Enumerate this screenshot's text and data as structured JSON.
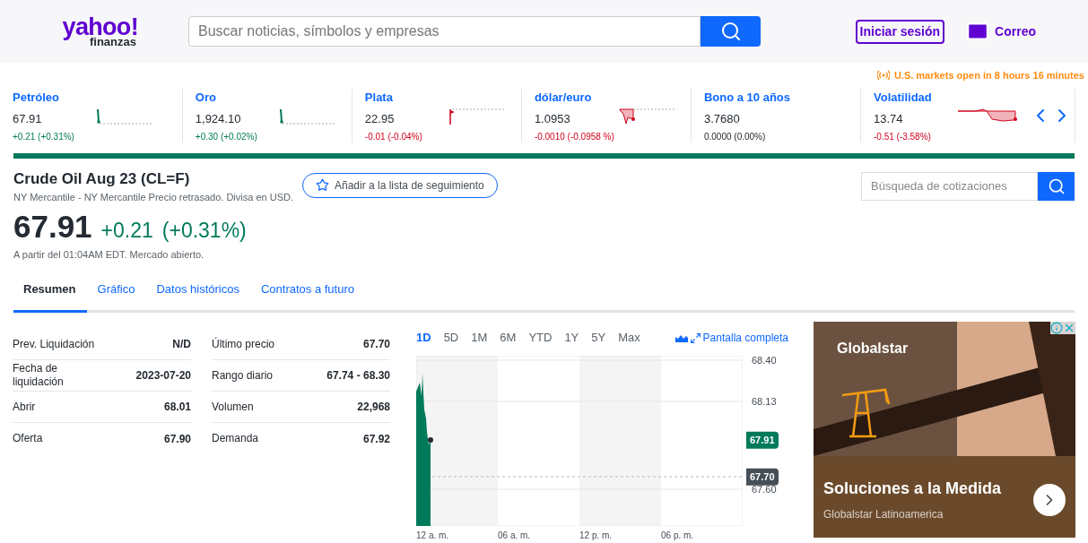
{
  "header": {
    "logo": {
      "brand": "yahoo!",
      "sub": "finanzas"
    },
    "search": {
      "placeholder": "Buscar noticias, símbolos y empresas"
    },
    "signin": "Iniciar sesión",
    "mail": "Correo"
  },
  "market_notice": "U.S. markets open in 8 hours 16 minutes",
  "tickers": [
    {
      "name": "Petróleo",
      "price": "67.91",
      "change": "+0.21 (+0.31%)",
      "kind": "spike"
    },
    {
      "name": "Oro",
      "price": "1,924.10",
      "change": "+0.30 (+0.02%)",
      "kind": "spike"
    },
    {
      "name": "Plata",
      "price": "22.95",
      "change": "-0.01 (-0.04%)",
      "kind": "drop"
    },
    {
      "name": "dólar/euro",
      "price": "1.0953",
      "change": "-0.0010 (-0.0958 %)",
      "kind": "dip"
    },
    {
      "name": "Bono a 10 años",
      "price": "3.7680",
      "change": "0.0000 (0.00%)",
      "kind": "plain"
    },
    {
      "name": "Volatilidad",
      "price": "13.74",
      "change": "-0.51 (-3.58%)",
      "kind": "slide"
    }
  ],
  "quote": {
    "title": "Crude Oil Aug 23 (CL=F)",
    "subtitle": "NY Mercantile - NY Mercantile Precio retrasado. Divisa en USD.",
    "watchlist": "Añadir a la lista de seguimiento",
    "price": "67.91",
    "change": "+0.21",
    "percent": "(+0.31%)",
    "timestamp": "A partir del 01:04AM EDT. Mercado abierto.",
    "quote_search_placeholder": "Búsqueda de cotizaciones"
  },
  "tabs": [
    {
      "label": "Resumen",
      "selected": true
    },
    {
      "label": "Gráfico",
      "selected": false
    },
    {
      "label": "Datos históricos",
      "selected": false
    },
    {
      "label": "Contratos a futuro",
      "selected": false
    }
  ],
  "stats": [
    [
      {
        "label": "Prev. Liquidación",
        "value": "N/D"
      },
      {
        "label": "Fecha de liquidación",
        "value": "2023-07-20"
      },
      {
        "label": "Abrir",
        "value": "68.01"
      },
      {
        "label": "Oferta",
        "value": "67.90"
      }
    ],
    [
      {
        "label": "Último precio",
        "value": "67.70"
      },
      {
        "label": "Rango diario",
        "value": "67.74 - 68.30"
      },
      {
        "label": "Volumen",
        "value": "22,968"
      },
      {
        "label": "Demanda",
        "value": "67.92"
      }
    ]
  ],
  "chart": {
    "ranges": [
      {
        "label": "1D",
        "selected": true
      },
      {
        "label": "5D",
        "selected": false
      },
      {
        "label": "1M",
        "selected": false
      },
      {
        "label": "6M",
        "selected": false
      },
      {
        "label": "YTD",
        "selected": false
      },
      {
        "label": "1Y",
        "selected": false
      },
      {
        "label": "5Y",
        "selected": false
      },
      {
        "label": "Max",
        "selected": false
      }
    ],
    "fullscreen": "Pantalla completa",
    "time_labels": [
      "12 a. m.",
      "06 a. m.",
      "12 p. m.",
      "06 p. m."
    ],
    "y_labels": [
      "68.40",
      "68.13",
      "67.60"
    ],
    "price_tags": [
      {
        "text": "67.91",
        "kind": "current"
      },
      {
        "text": "67.70",
        "kind": "previous"
      }
    ]
  },
  "ad": {
    "brand": "Globalstar",
    "headline": "Soluciones a la Medida",
    "advertiser": "Globalstar Latinoamerica"
  }
}
